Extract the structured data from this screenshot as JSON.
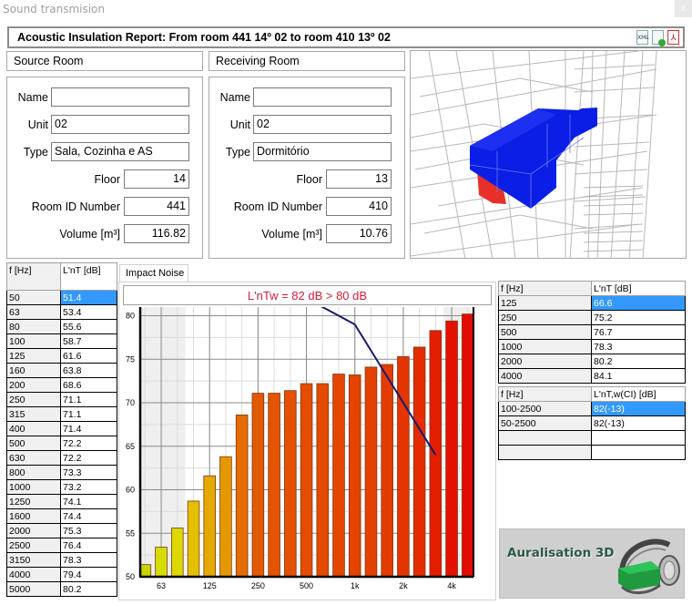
{
  "window": {
    "title": "Sound transmision",
    "close_label": "x"
  },
  "report": {
    "title": "Acoustic Insulation Report: From room 441  14º 02 to room 410  13º 02",
    "icons": [
      "xml-export-icon",
      "add-document-icon",
      "pdf-export-icon"
    ],
    "icon_labels": {
      "xml": "XML",
      "pdf": "⅄"
    }
  },
  "source_room": {
    "heading": "Source Room",
    "fields": {
      "name": {
        "label": "Name",
        "value": ""
      },
      "unit": {
        "label": "Unit",
        "value": "02"
      },
      "type": {
        "label": "Type",
        "value": "Sala, Cozinha e AS"
      },
      "floor": {
        "label": "Floor",
        "value": "14"
      },
      "room_id": {
        "label": "Room ID Number",
        "value": "441"
      },
      "volume": {
        "label": "Volume [m³]",
        "value": "116.82"
      }
    }
  },
  "receiving_room": {
    "heading": "Receiving Room",
    "fields": {
      "name": {
        "label": "Name",
        "value": ""
      },
      "unit": {
        "label": "Unit",
        "value": "02"
      },
      "type": {
        "label": "Type",
        "value": "Dormitório"
      },
      "floor": {
        "label": "Floor",
        "value": "13"
      },
      "room_id": {
        "label": "Room ID Number",
        "value": "410"
      },
      "volume": {
        "label": "Volume [m³]",
        "value": "10.76"
      }
    }
  },
  "third_octave_table": {
    "headers": [
      "f [Hz]",
      "L'nT [dB]"
    ],
    "selected_row": 0,
    "rows": [
      [
        "50",
        "51.4"
      ],
      [
        "63",
        "53.4"
      ],
      [
        "80",
        "55.6"
      ],
      [
        "100",
        "58.7"
      ],
      [
        "125",
        "61.6"
      ],
      [
        "160",
        "63.8"
      ],
      [
        "200",
        "68.6"
      ],
      [
        "250",
        "71.1"
      ],
      [
        "315",
        "71.1"
      ],
      [
        "400",
        "71.4"
      ],
      [
        "500",
        "72.2"
      ],
      [
        "630",
        "72.2"
      ],
      [
        "800",
        "73.3"
      ],
      [
        "1000",
        "73.2"
      ],
      [
        "1250",
        "74.1"
      ],
      [
        "1600",
        "74.4"
      ],
      [
        "2000",
        "75.3"
      ],
      [
        "2500",
        "76.4"
      ],
      [
        "3150",
        "78.3"
      ],
      [
        "4000",
        "79.4"
      ],
      [
        "5000",
        "80.2"
      ]
    ]
  },
  "octave_table": {
    "headers": [
      "f [Hz]",
      "L'nT [dB]"
    ],
    "selected_row": 0,
    "rows": [
      [
        "125",
        "66.6"
      ],
      [
        "250",
        "75.2"
      ],
      [
        "500",
        "76.7"
      ],
      [
        "1000",
        "78.3"
      ],
      [
        "2000",
        "80.2"
      ],
      [
        "4000",
        "84.1"
      ]
    ]
  },
  "rating_table": {
    "headers": [
      "f [Hz]",
      "L'nT,w(CI) [dB]"
    ],
    "selected_row": 0,
    "rows": [
      [
        "100-2500",
        "82(-13)"
      ],
      [
        "50-2500",
        "82(-13)"
      ],
      [
        "",
        ""
      ],
      [
        "",
        ""
      ]
    ]
  },
  "chart_tab": {
    "label": "Impact Noise"
  },
  "verdict": {
    "text": "L'nTw = 82 dB > 80 dB",
    "color": "#d0203a"
  },
  "chart_data": {
    "type": "bar",
    "title": "L'nTw = 82 dB > 80 dB",
    "xlabel": "",
    "ylabel": "",
    "categories": [
      "50",
      "63",
      "80",
      "100",
      "125",
      "160",
      "200",
      "250",
      "315",
      "400",
      "500",
      "630",
      "800",
      "1000",
      "1250",
      "1600",
      "2000",
      "2500",
      "3150",
      "4000",
      "5000"
    ],
    "series": [
      {
        "name": "L'nT [dB]",
        "type": "bar",
        "values": [
          51.4,
          53.4,
          55.6,
          58.7,
          61.6,
          63.8,
          68.6,
          71.1,
          71.1,
          71.4,
          72.2,
          72.2,
          73.3,
          73.2,
          74.1,
          74.4,
          75.3,
          76.4,
          78.3,
          79.4,
          80.2
        ]
      },
      {
        "name": "Reference curve (shifted)",
        "type": "line",
        "color": "#1a1a6e",
        "x": [
          "400",
          "500",
          "630",
          "800",
          "1000",
          "1250",
          "1600",
          "2000",
          "2500",
          "3150"
        ],
        "values": [
          82,
          82,
          81,
          80,
          79,
          76,
          73,
          70,
          67,
          64
        ]
      }
    ],
    "ylim": [
      50,
      81
    ],
    "yticks": [
      50,
      55,
      60,
      65,
      70,
      75,
      80
    ],
    "xtick_labels": [
      {
        "at": "63",
        "label": "63"
      },
      {
        "at": "125",
        "label": "125"
      },
      {
        "at": "250",
        "label": "250"
      },
      {
        "at": "500",
        "label": "500"
      },
      {
        "at": "1000",
        "label": "1k"
      },
      {
        "at": "2000",
        "label": "2k"
      },
      {
        "at": "4000",
        "label": "4k"
      }
    ],
    "shaded_ranges": [
      [
        "50",
        "80"
      ],
      [
        "4000",
        "5000"
      ]
    ],
    "grid": true,
    "bar_colors": [
      "#c8d400",
      "#d4dc00",
      "#dcd800",
      "#e4c000",
      "#e4a800",
      "#e49800",
      "#e46c00",
      "#e45800",
      "#e45400",
      "#e45000",
      "#e44c00",
      "#e44a00",
      "#e44600",
      "#e44400",
      "#e44000",
      "#e43c00",
      "#e43400",
      "#e42c00",
      "#e41c00",
      "#e41000",
      "#e40c00"
    ]
  },
  "branding": {
    "logo_text": "Auralisation 3D"
  }
}
